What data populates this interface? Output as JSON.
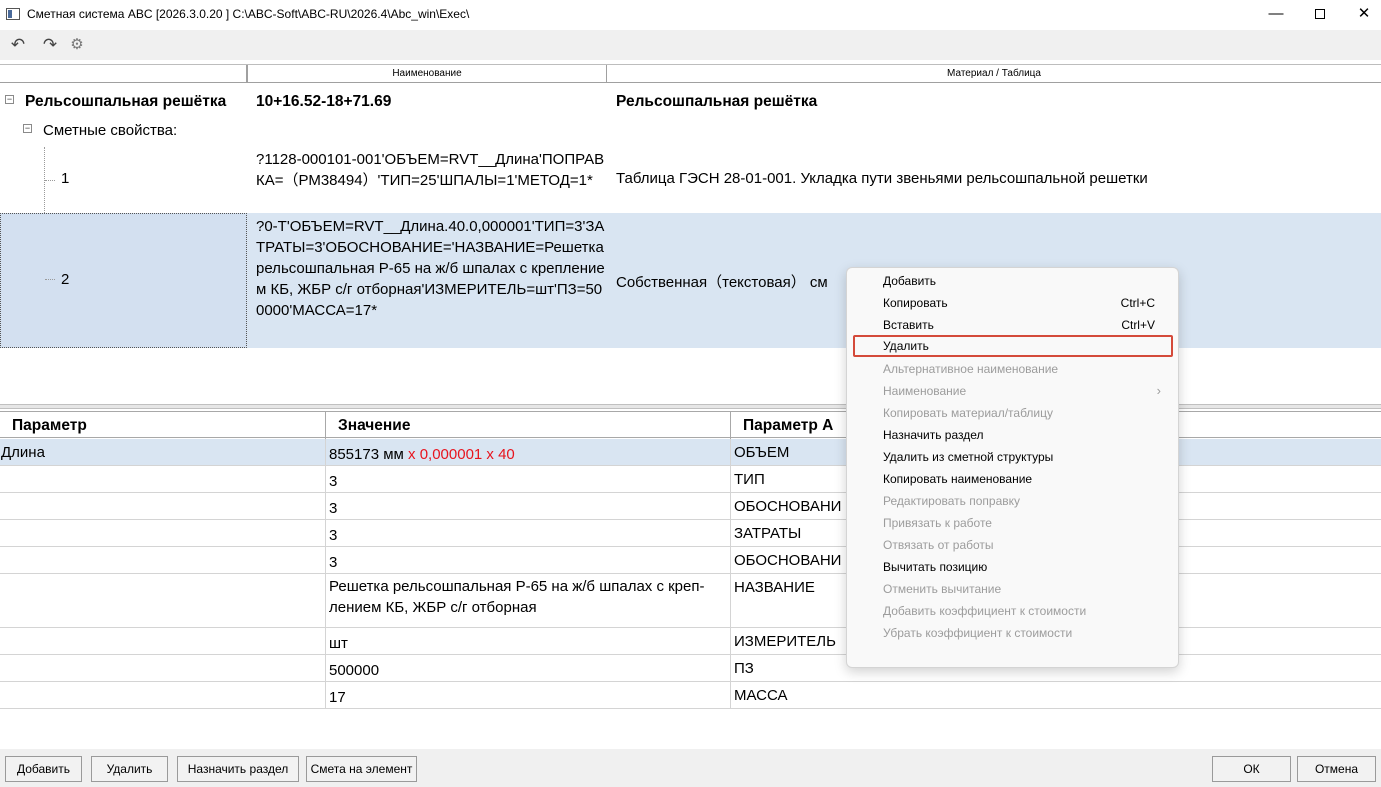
{
  "window": {
    "title": "Сметная система ABC [2026.3.0.20 ]   C:\\ABC-Soft\\ABC-RU\\2026.4\\Abc_win\\Exec\\",
    "minimize": "—",
    "close": "✕"
  },
  "toolbar": {
    "undo_icon": "↶",
    "redo_icon": "↷",
    "gear_icon": "⚙"
  },
  "tree": {
    "columns": [
      "",
      "Наименование",
      "Материал / Таблица"
    ],
    "root": {
      "expander": "−",
      "name": "Рельсошпальная решётка",
      "code": "10+16.52-18+71.69",
      "material": "Рельсошпальная решётка"
    },
    "props": {
      "expander": "−",
      "label": "Сметные свойства:"
    },
    "items": [
      {
        "num": "1",
        "formula": "?1128-000101-001'ОБЪЕМ=RVT__Длина'ПОПРАВКА=（РМ38494）'ТИП=25'ШПАЛЫ=1'МЕТОД=1*",
        "material": "Таблица ГЭСН 28-01-001. Укладка пути звеньями рельсошпальной решетки"
      },
      {
        "num": "2",
        "formula": "?0-Т'ОБЪЕМ=RVT__Длина.40.0,000001'ТИП=3'ЗАТРАТЫ=3'ОБОСНОВАНИЕ='НАЗВАНИЕ=Решетка рельсошпальная Р-65 на ж/б шпалах с креплением КБ, ЖБР с/г отборная'ИЗМЕРИТЕЛЬ=шт'ПЗ=500000'МАССА=17*",
        "material": "Собственная（текстовая） см"
      }
    ]
  },
  "grid": {
    "headers": [
      "Параметр",
      "Значение",
      "Параметр А"
    ],
    "rows": [
      {
        "param": "Длина",
        "value": "855173 мм",
        "value_extra": " x  0,000001 x 40",
        "abc": "ОБЪЕМ"
      },
      {
        "param": "",
        "value": "3",
        "value_extra": "",
        "abc": "ТИП"
      },
      {
        "param": "",
        "value": "3",
        "value_extra": "",
        "abc": "ОБОСНОВАНИ"
      },
      {
        "param": "",
        "value": "3",
        "value_extra": "",
        "abc": "ЗАТРАТЫ"
      },
      {
        "param": "",
        "value": "3",
        "value_extra": "",
        "abc": "ОБОСНОВАНИ"
      },
      {
        "param": "",
        "value": "Решетка рельсошпальная Р-65 на ж/б шпалах с креп-лением КБ, ЖБР с/г отборная",
        "value_extra": "",
        "abc": "НАЗВАНИЕ"
      },
      {
        "param": "",
        "value": "шт",
        "value_extra": "",
        "abc": "ИЗМЕРИТЕЛЬ"
      },
      {
        "param": "",
        "value": "500000",
        "value_extra": "",
        "abc": "ПЗ"
      },
      {
        "param": "",
        "value": "17",
        "value_extra": "",
        "abc": "МАССА"
      }
    ]
  },
  "buttons": {
    "add": "Добавить",
    "delete": "Удалить",
    "assign_section": "Назначить раздел",
    "estimate": "Смета на элемент",
    "ok": "ОК",
    "cancel": "Отмена"
  },
  "context_menu": {
    "items": [
      {
        "label": "Добавить",
        "shortcut": "",
        "disabled": false
      },
      {
        "label": "Копировать",
        "shortcut": "Ctrl+C",
        "disabled": false
      },
      {
        "label": "Вставить",
        "shortcut": "Ctrl+V",
        "disabled": false
      },
      {
        "label": "Удалить",
        "shortcut": "",
        "disabled": false,
        "highlighted": true
      },
      {
        "label": "Альтернативное наименование",
        "shortcut": "",
        "disabled": true
      },
      {
        "label": "Наименование",
        "shortcut": "",
        "disabled": true,
        "submenu": "›"
      },
      {
        "label": "Копировать материал/таблицу",
        "shortcut": "",
        "disabled": true
      },
      {
        "label": "Назначить раздел",
        "shortcut": "",
        "disabled": false
      },
      {
        "label": "Удалить из сметной структуры",
        "shortcut": "",
        "disabled": false
      },
      {
        "label": "Копировать наименование",
        "shortcut": "",
        "disabled": false
      },
      {
        "label": "Редактировать поправку",
        "shortcut": "",
        "disabled": true
      },
      {
        "label": "Привязать к работе",
        "shortcut": "",
        "disabled": true
      },
      {
        "label": "Отвязать от работы",
        "shortcut": "",
        "disabled": true
      },
      {
        "label": "Вычитать позицию",
        "shortcut": "",
        "disabled": false
      },
      {
        "label": "Отменить вычитание",
        "shortcut": "",
        "disabled": true
      },
      {
        "label": "Добавить коэффициент к стоимости",
        "shortcut": "",
        "disabled": true
      },
      {
        "label": "Убрать коэффициент к стоимости",
        "shortcut": "",
        "disabled": true
      }
    ]
  }
}
